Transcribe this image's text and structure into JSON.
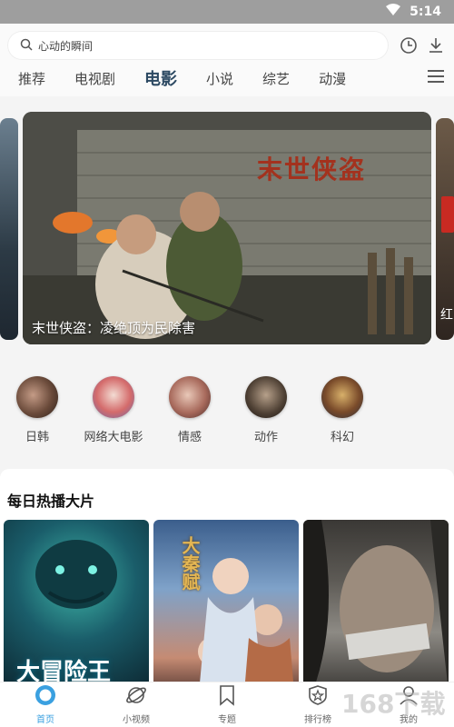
{
  "status_bar": {
    "time": "5:14"
  },
  "search": {
    "placeholder": "心动的瞬间"
  },
  "tabs": [
    "推荐",
    "电视剧",
    "电影",
    "小说",
    "综艺",
    "动漫"
  ],
  "active_tab": "电影",
  "hero": {
    "caption": "末世侠盗：凌绝顶为民除害",
    "title_art": "末世侠盗",
    "side_caption": "红"
  },
  "categories": [
    "日韩",
    "网络大电影",
    "情感",
    "动作",
    "科幻"
  ],
  "section": {
    "title": "每日热播大片"
  },
  "posters": [
    {
      "title": "大冒险王"
    },
    {
      "title": "大秦赋"
    },
    {
      "title": ""
    }
  ],
  "bottom_nav": [
    "首页",
    "小视频",
    "专题",
    "排行榜",
    "我的"
  ],
  "colors": {
    "accent": "#3aa0e0",
    "active_tab": "#2d4a63",
    "status_bar": "#9e9e9e"
  }
}
